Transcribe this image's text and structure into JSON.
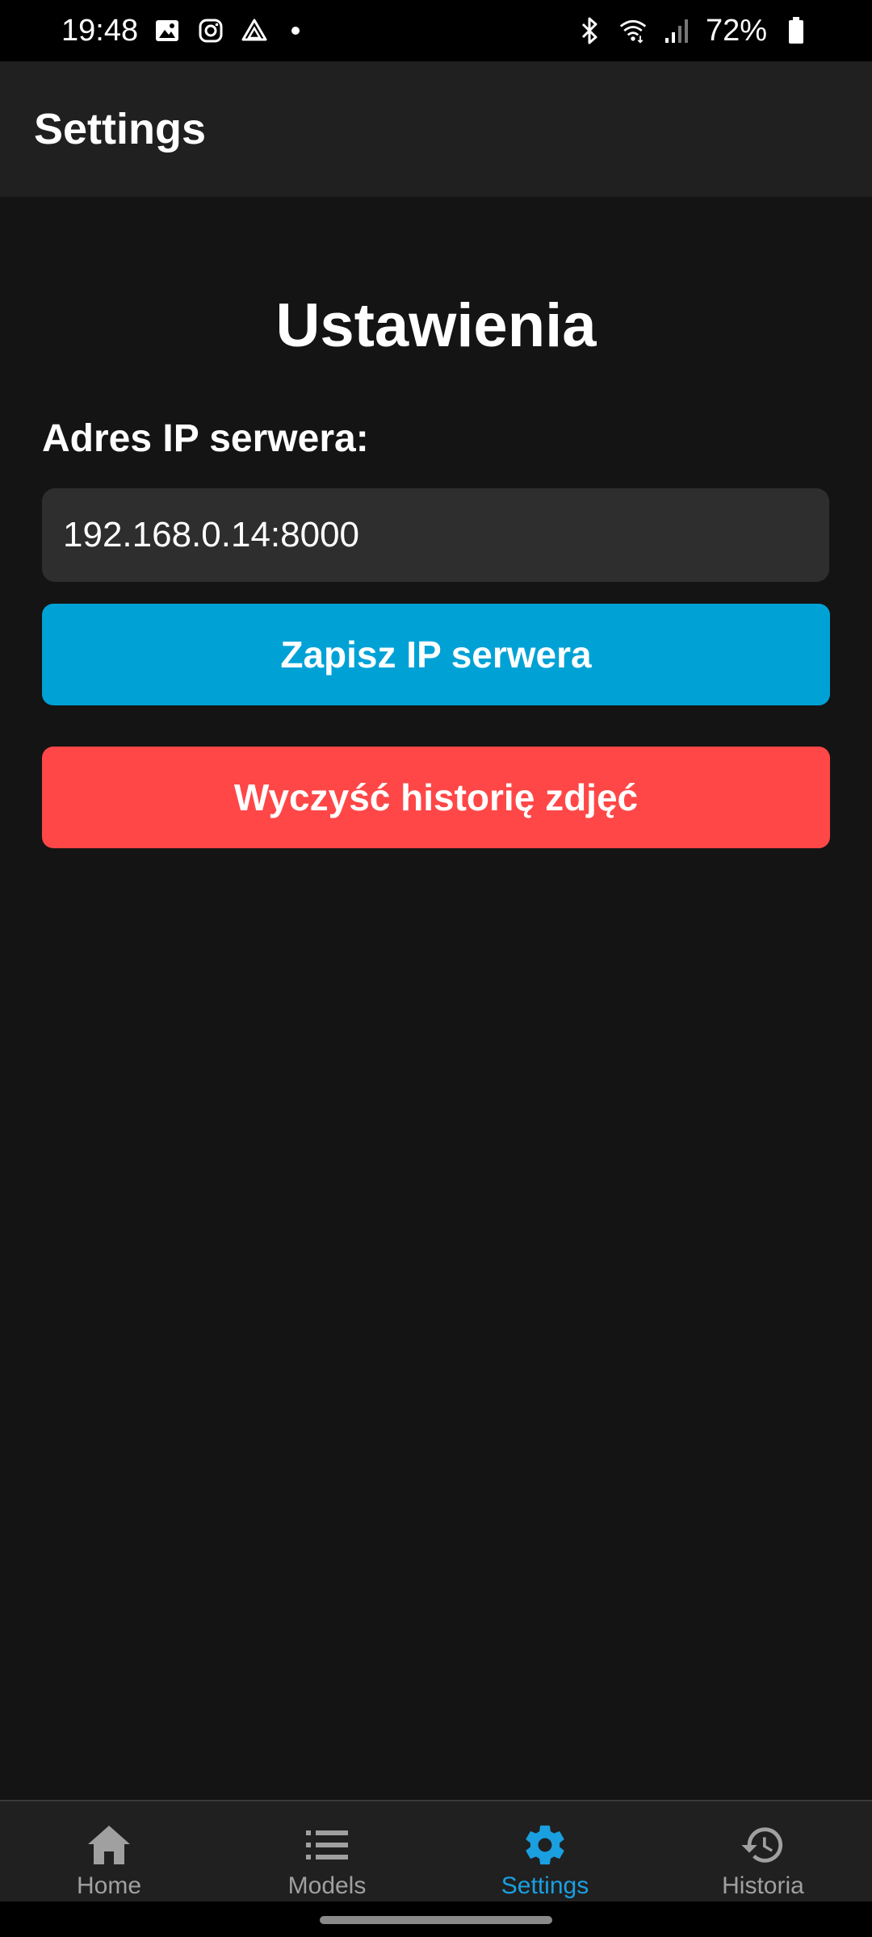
{
  "status_bar": {
    "time": "19:48",
    "battery": "72%",
    "left_icons": [
      "gallery-icon",
      "instagram-icon",
      "drive-icon"
    ],
    "right_icons": [
      "bluetooth-icon",
      "wifi-icon",
      "signal-icon",
      "battery-icon"
    ]
  },
  "header": {
    "title": "Settings"
  },
  "main": {
    "title": "Ustawienia",
    "ip_label": "Adres IP serwera:",
    "ip_value": "192.168.0.14:8000",
    "save_button": "Zapisz IP serwera",
    "clear_button": "Wyczyść historię zdjęć"
  },
  "colors": {
    "save_button": "#00a2d6",
    "clear_button": "#ff4747",
    "active_tab": "#1a9fe0",
    "inactive_tab": "#a0a0a0"
  },
  "bottom_nav": {
    "items": [
      {
        "label": "Home",
        "icon": "home-icon"
      },
      {
        "label": "Models",
        "icon": "list-icon"
      },
      {
        "label": "Settings",
        "icon": "gear-icon",
        "active": true
      },
      {
        "label": "Historia",
        "icon": "history-icon"
      }
    ]
  }
}
